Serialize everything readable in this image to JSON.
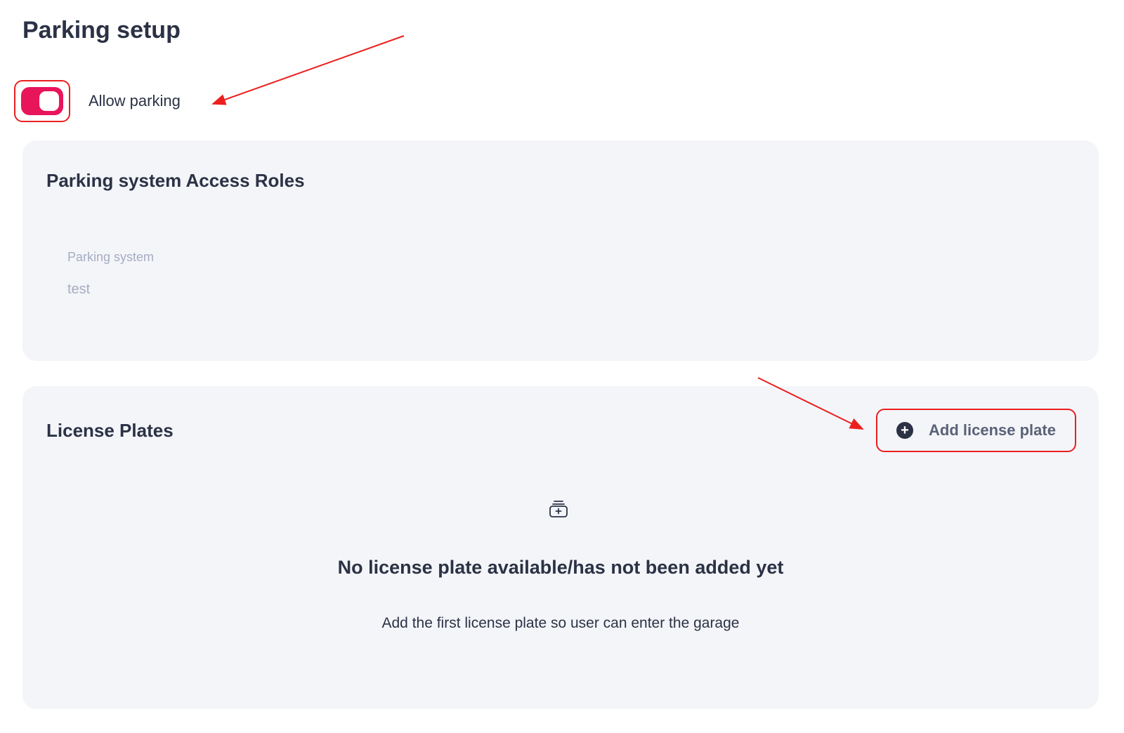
{
  "page": {
    "title": "Parking setup"
  },
  "parking_toggle": {
    "label": "Allow parking",
    "enabled": true
  },
  "access_roles": {
    "title": "Parking system Access Roles",
    "field_label": "Parking system",
    "field_value": "test"
  },
  "license_plates": {
    "title": "License Plates",
    "add_button_label": "Add license plate",
    "add_button_icon": "plus-circle-icon",
    "empty_icon": "parking-garage-icon",
    "empty_title": "No license plate available/has not been added yet",
    "empty_subtitle": "Add the first license plate so user can enter the garage"
  },
  "colors": {
    "accent": "#e8155a",
    "annotation_red": "#ec1f1f",
    "text_dark": "#2b3245",
    "text_muted": "#a6adc2",
    "card_bg": "#f4f5f9"
  }
}
